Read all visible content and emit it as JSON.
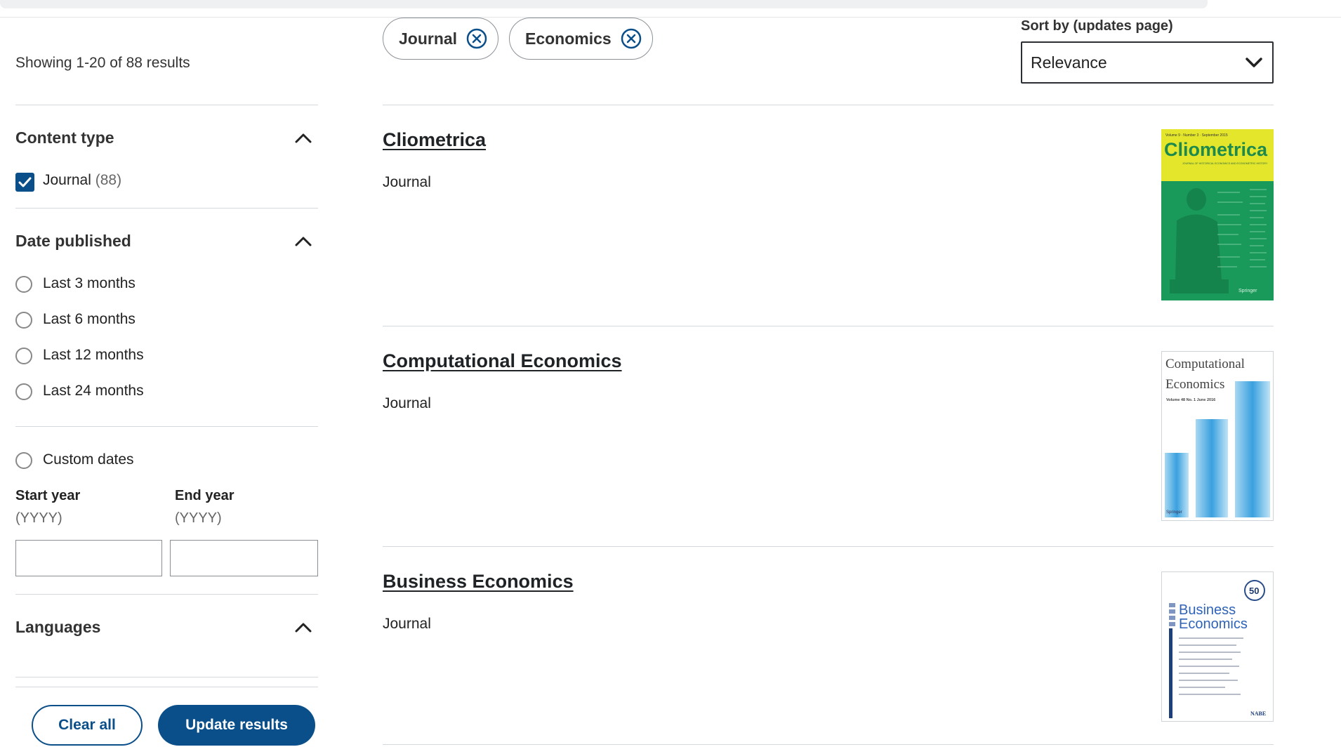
{
  "sidebar": {
    "showing": "Showing 1-20 of 88 results",
    "content_type": {
      "title": "Content type",
      "options": [
        {
          "label": "Journal",
          "count": "(88)",
          "checked": true
        }
      ]
    },
    "date_published": {
      "title": "Date published",
      "options": [
        {
          "label": "Last 3 months"
        },
        {
          "label": "Last 6 months"
        },
        {
          "label": "Last 12 months"
        },
        {
          "label": "Last 24 months"
        }
      ],
      "custom": "Custom dates",
      "start_label": "Start year",
      "start_hint": "(YYYY)",
      "end_label": "End year",
      "end_hint": "(YYYY)",
      "start_value": "",
      "end_value": ""
    },
    "languages": {
      "title": "Languages"
    },
    "buttons": {
      "clear": "Clear all",
      "update": "Update results"
    }
  },
  "filters": {
    "chips": [
      {
        "label": "Journal"
      },
      {
        "label": "Economics"
      }
    ]
  },
  "sort": {
    "label": "Sort by (updates page)",
    "value": "Relevance"
  },
  "results": [
    {
      "title": "Cliometrica",
      "type": "Journal",
      "cover": {
        "title": "Cliometrica",
        "subtitle": "JOURNAL OF HISTORICAL ECONOMICS AND ECONOMETRIC HISTORY",
        "publisher": "Springer",
        "issue": "Volume 9 · Number 3 · September 2015"
      }
    },
    {
      "title": "Computational Economics",
      "type": "Journal",
      "cover": {
        "title_line1": "Computational",
        "title_line2": "Economics",
        "issue": "Volume 48 No. 1 June 2016",
        "publisher": "Springer"
      }
    },
    {
      "title": "Business Economics",
      "type": "Journal",
      "cover": {
        "title_line1": "Business",
        "title_line2": "Economics",
        "badge": "50",
        "publisher": "NABE"
      }
    }
  ],
  "colors": {
    "accent": "#0b4f8a",
    "cliometrica_yellow": "#e4e62c",
    "cliometrica_green": "#1a9a5a"
  }
}
